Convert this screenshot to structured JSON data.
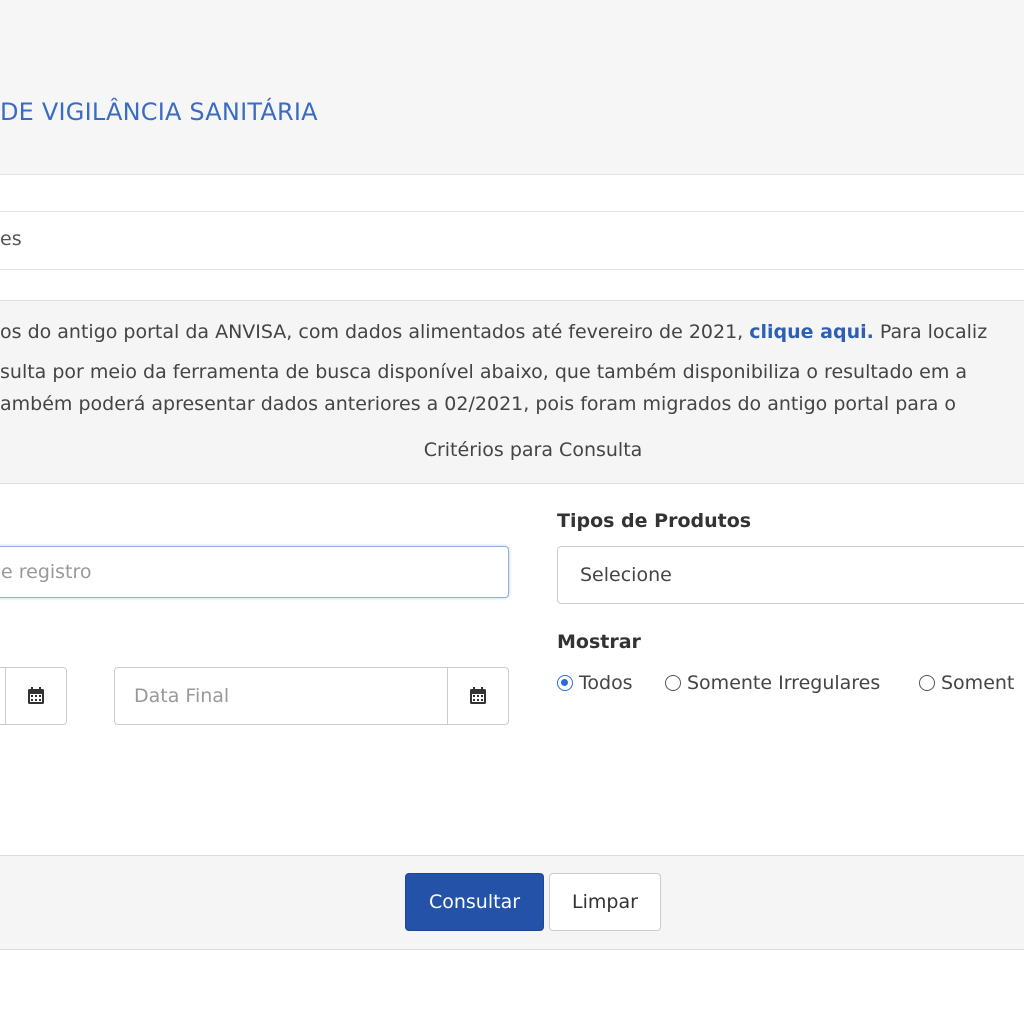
{
  "header": {
    "title": "DE VIGILÂNCIA SANITÁRIA"
  },
  "breadcrumb": {
    "text": "es"
  },
  "info": {
    "line1_before": "os do antigo portal da ANVISA, com dados alimentados até fevereiro de 2021, ",
    "line1_link": "clique aqui.",
    "line1_after": " Para localiz",
    "line2": "sulta por meio da ferramenta de busca disponível abaixo, que também disponibiliza o resultado em a",
    "line3": "ambém poderá apresentar dados anteriores a 02/2021, pois foram migrados do antigo portal para o"
  },
  "criteria": {
    "title": "Critérios para Consulta"
  },
  "form": {
    "registro_placeholder": "e registro",
    "data_final_placeholder": "Data Final",
    "tipos_label": "Tipos de Produtos",
    "tipos_selected": "Selecione",
    "mostrar_label": "Mostrar",
    "radios": [
      "Todos",
      "Somente Irregulares",
      "Soment"
    ]
  },
  "buttons": {
    "consultar": "Consultar",
    "limpar": "Limpar"
  },
  "colors": {
    "accent": "#2352a8",
    "title_blue": "#3b6cc3",
    "radio_blue": "#2a6fd0"
  },
  "icons": {
    "calendar": "calendar-icon"
  }
}
